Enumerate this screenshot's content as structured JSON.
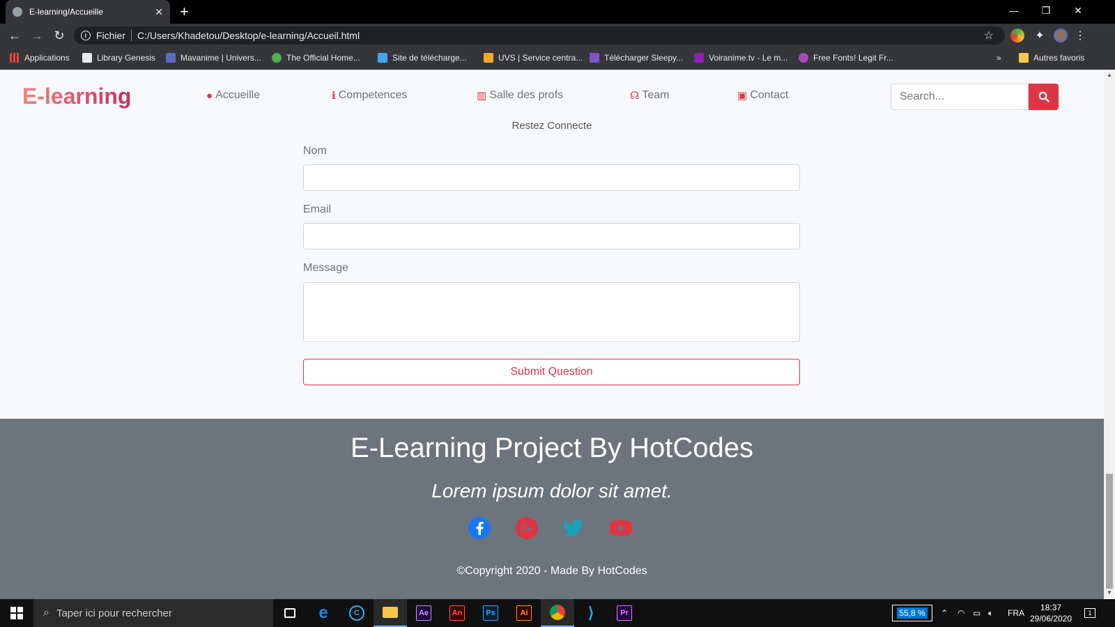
{
  "browser": {
    "tab_title": "E-learning/Accueille",
    "new_tab": "+",
    "window_controls": {
      "minimize": "—",
      "restore": "❐",
      "close": "✕"
    },
    "omnibox": {
      "scheme_label": "Fichier",
      "url": "C:/Users/Khadetou/Desktop/e-learning/Accueil.html"
    },
    "bookmarks": [
      {
        "label": "Applications",
        "icon": "apps-grid-icon",
        "color": "#ea4335"
      },
      {
        "label": "Library Genesis",
        "icon": "book-icon",
        "color": "#e8eaed"
      },
      {
        "label": "Mavanime | Univers...",
        "icon": "anime-icon",
        "color": "#5c6bc0"
      },
      {
        "label": "The Official Home...",
        "icon": "leaf-icon",
        "color": "#4caf50"
      },
      {
        "label": "Site de télécharge...",
        "icon": "download-icon",
        "color": "#42a5f5"
      },
      {
        "label": "UVS | Service centra...",
        "icon": "uvs-icon",
        "color": "#f9a825"
      },
      {
        "label": "Télécharger Sleepy...",
        "icon": "moon-icon",
        "color": "#7e57c2"
      },
      {
        "label": "Voiranime.tv - Le m...",
        "icon": "play-icon",
        "color": "#8e24aa"
      },
      {
        "label": "Free Fonts! Legit Fr...",
        "icon": "font-icon",
        "color": "#ab47bc"
      }
    ],
    "bookmarks_overflow": "»",
    "other_bookmarks": "Autres favoris"
  },
  "site": {
    "brand": "E-learning",
    "nav": [
      {
        "label": "Accueille",
        "icon": "speech-bubble-icon",
        "glyph": "●"
      },
      {
        "label": "Competences",
        "icon": "info-circle-icon",
        "glyph": "ℹ"
      },
      {
        "label": "Salle des profs",
        "icon": "chalkboard-teacher-icon",
        "glyph": "▥"
      },
      {
        "label": "Team",
        "icon": "headset-icon",
        "glyph": "☊"
      },
      {
        "label": "Contact",
        "icon": "address-book-icon",
        "glyph": "▣"
      }
    ],
    "search": {
      "placeholder": "Search..."
    },
    "accent_color": "#dc3545"
  },
  "contact_form": {
    "subtitle": "Restez Connecte",
    "name_label": "Nom",
    "name_value": "",
    "email_label": "Email",
    "email_value": "",
    "message_label": "Message",
    "message_value": "",
    "submit_label": "Submit Question"
  },
  "footer": {
    "title": "E-Learning Project By HotCodes",
    "tagline": "Lorem ipsum dolor sit amet.",
    "social": [
      {
        "name": "facebook-icon",
        "color": "#1877f2"
      },
      {
        "name": "google-plus-icon",
        "color": "#dc3545"
      },
      {
        "name": "twitter-icon",
        "color": "#17a2b8"
      },
      {
        "name": "youtube-icon",
        "color": "#dc3545"
      }
    ],
    "copyright": "©Copyright 2020 - Made By HotCodes"
  },
  "taskbar": {
    "search_placeholder": "Taper ici pour rechercher",
    "apps": [
      {
        "name": "task-view-icon",
        "label": ""
      },
      {
        "name": "edge-icon",
        "label": "e"
      },
      {
        "name": "ccleaner-icon",
        "label": "C"
      },
      {
        "name": "file-explorer-icon",
        "label": ""
      },
      {
        "name": "after-effects-icon",
        "label": "Ae"
      },
      {
        "name": "animate-icon",
        "label": "An"
      },
      {
        "name": "photoshop-icon",
        "label": "Ps"
      },
      {
        "name": "illustrator-icon",
        "label": "Ai"
      },
      {
        "name": "chrome-icon",
        "label": ""
      },
      {
        "name": "vscode-icon",
        "label": ""
      },
      {
        "name": "premiere-icon",
        "label": "Pr"
      }
    ],
    "zoom_value": "55,8 %",
    "language": "FRA",
    "time": "18:37",
    "date": "29/06/2020",
    "notifications": "1"
  }
}
